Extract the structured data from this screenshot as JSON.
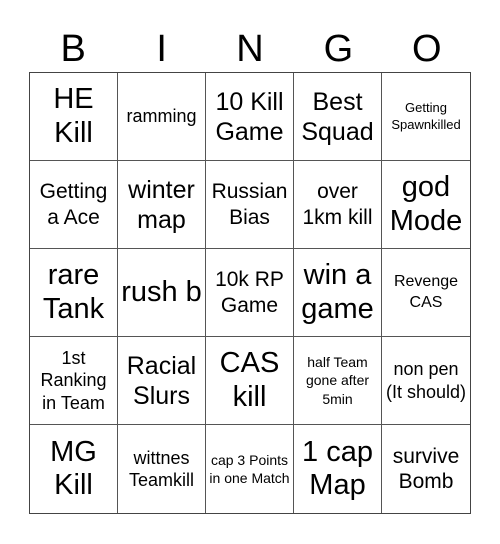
{
  "header": {
    "letters": [
      "B",
      "I",
      "N",
      "G",
      "O"
    ]
  },
  "cells": [
    {
      "text": "HE Kill"
    },
    {
      "text": "ramming"
    },
    {
      "text": "10 Kill Game"
    },
    {
      "text": "Best Squad"
    },
    {
      "text": "Getting Spawnkilled"
    },
    {
      "text": "Getting a Ace"
    },
    {
      "text": "winter map"
    },
    {
      "text": "Russian Bias"
    },
    {
      "text": "over 1km kill"
    },
    {
      "text": "god Mode"
    },
    {
      "text": "rare Tank"
    },
    {
      "text": "rush b"
    },
    {
      "text": "10k RP Game"
    },
    {
      "text": "win a game"
    },
    {
      "text": "Revenge CAS"
    },
    {
      "text": "1st Ranking in Team"
    },
    {
      "text": "Racial Slurs"
    },
    {
      "text": "CAS kill"
    },
    {
      "text": "half Team gone after 5min"
    },
    {
      "text": "non pen (It should)"
    },
    {
      "text": "MG Kill"
    },
    {
      "text": "wittnes Teamkill"
    },
    {
      "text": "cap 3 Points in one Match"
    },
    {
      "text": "1 cap Map"
    },
    {
      "text": "survive Bomb"
    }
  ]
}
